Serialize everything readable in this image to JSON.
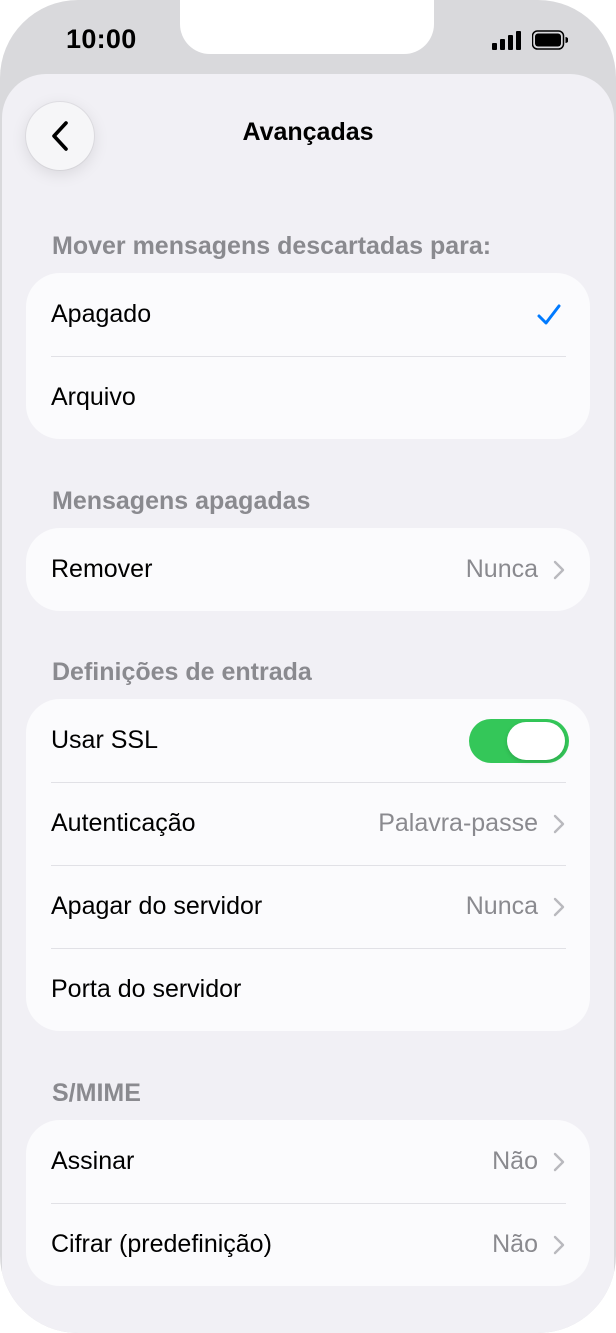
{
  "status_bar": {
    "time": "10:00"
  },
  "nav": {
    "title": "Avançadas",
    "back_icon": "chevron-left-icon"
  },
  "sections": [
    {
      "header": "Mover mensagens descartadas para:",
      "rows": [
        {
          "label": "Apagado",
          "selected": true
        },
        {
          "label": "Arquivo",
          "selected": false
        }
      ]
    },
    {
      "header": "Mensagens apagadas",
      "rows": [
        {
          "label": "Remover",
          "value": "Nunca"
        }
      ]
    },
    {
      "header": "Definições de entrada",
      "rows": [
        {
          "label": "Usar SSL",
          "toggle_on": true
        },
        {
          "label": "Autenticação",
          "value": "Palavra-passe"
        },
        {
          "label": "Apagar do servidor",
          "value": "Nunca"
        },
        {
          "label": "Porta do servidor"
        }
      ]
    },
    {
      "header": "S/MIME",
      "rows": [
        {
          "label": "Assinar",
          "value": "Não"
        },
        {
          "label": "Cifrar (predefinição)",
          "value": "Não"
        }
      ]
    }
  ],
  "colors": {
    "accent": "#007aff",
    "toggle_on": "#34c759",
    "secondary_text": "#8a8a8f",
    "background": "#f1f0f5"
  }
}
